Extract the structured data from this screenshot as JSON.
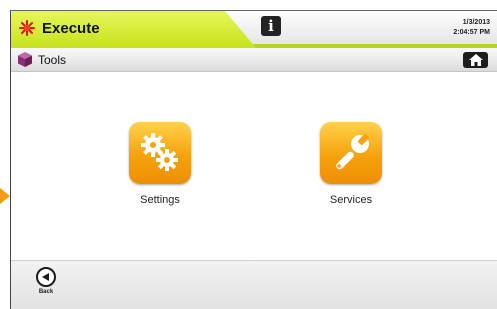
{
  "header": {
    "app_title": "Execute",
    "app_icon": "laser-icon",
    "info_icon": "info-icon",
    "info_label": "i",
    "date": "1/3/2013",
    "time": "2:04:57 PM"
  },
  "toolbar": {
    "title": "Tools",
    "icon": "tools-cube-icon",
    "home_icon": "home-icon"
  },
  "tiles": [
    {
      "label": "Settings",
      "icon": "gears-icon"
    },
    {
      "label": "Services",
      "icon": "wrench-icon"
    }
  ],
  "footer": {
    "back_label": "Back",
    "back_icon": "back-arrow-icon"
  },
  "colors": {
    "accent_green": "#c8e21b",
    "tile_orange": "#f5a20c",
    "laser_red": "#e0141e"
  }
}
